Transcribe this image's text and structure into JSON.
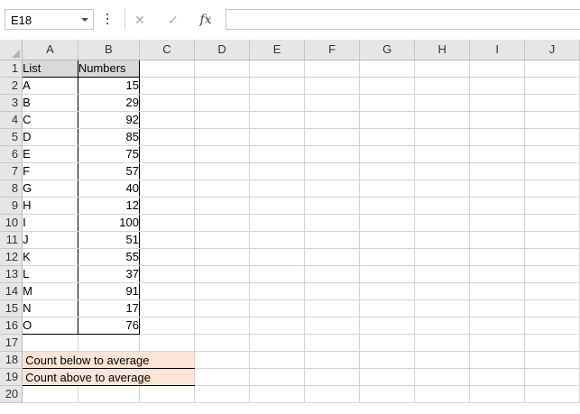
{
  "formula_bar": {
    "name_box": "E18",
    "cancel_icon": "✕",
    "enter_icon": "✓",
    "fx_label": "fx",
    "formula_value": ""
  },
  "columns": [
    "A",
    "B",
    "C",
    "D",
    "E",
    "F",
    "G",
    "H",
    "I",
    "J"
  ],
  "header_row": {
    "A": "List",
    "B": "Numbers"
  },
  "rows": [
    {
      "num": "1"
    },
    {
      "num": "2",
      "A": "A",
      "B": "15"
    },
    {
      "num": "3",
      "A": "B",
      "B": "29"
    },
    {
      "num": "4",
      "A": "C",
      "B": "92"
    },
    {
      "num": "5",
      "A": "D",
      "B": "85"
    },
    {
      "num": "6",
      "A": "E",
      "B": "75"
    },
    {
      "num": "7",
      "A": "F",
      "B": "57"
    },
    {
      "num": "8",
      "A": "G",
      "B": "40"
    },
    {
      "num": "9",
      "A": "H",
      "B": "12"
    },
    {
      "num": "10",
      "A": "I",
      "B": "100"
    },
    {
      "num": "11",
      "A": "J",
      "B": "51"
    },
    {
      "num": "12",
      "A": "K",
      "B": "55"
    },
    {
      "num": "13",
      "A": "L",
      "B": "37"
    },
    {
      "num": "14",
      "A": "M",
      "B": "91"
    },
    {
      "num": "15",
      "A": "N",
      "B": "17"
    },
    {
      "num": "16",
      "A": "O",
      "B": "76"
    },
    {
      "num": "17"
    },
    {
      "num": "18",
      "A": "Count below to average"
    },
    {
      "num": "19",
      "A": "Count above to average"
    },
    {
      "num": "20"
    }
  ],
  "colors": {
    "header_fill": "#d9d9d9",
    "highlight_fill": "#fce4d6",
    "grid_line": "#d4d4d4"
  }
}
